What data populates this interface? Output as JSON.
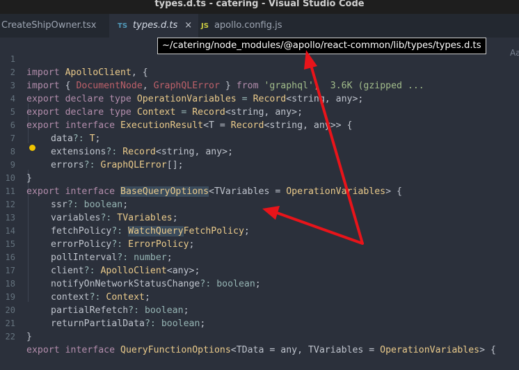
{
  "window": {
    "title": "types.d.ts - catering - Visual Studio Code"
  },
  "tabs": [
    {
      "label": "CreateShipOwner.tsx",
      "icon": ""
    },
    {
      "label": "types.d.ts",
      "icon": "TS",
      "close": "×"
    },
    {
      "label": "apollo.config.js",
      "icon": "JS"
    }
  ],
  "tooltip": {
    "path": "~/catering/node_modules/@apollo/react-common/lib/types/types.d.ts"
  },
  "find_widget": {
    "label": "Aa"
  },
  "lines": {
    "l1": {
      "n": "1",
      "a": "import",
      "b": "ApolloClient",
      "c": ", {"
    },
    "l2": {
      "n": "2",
      "a": "import",
      "b": "{ ",
      "c": "DocumentNode",
      "d": ", ",
      "e": "GraphQLError",
      "f": " } ",
      "g": "from",
      "h": " ",
      "i": "'graphql'",
      "j": ";  3.6K (gzipped ..."
    },
    "l3": {
      "n": "3",
      "a": "export declare type",
      "b": "OperationVariables",
      "c": " = ",
      "d": "Record",
      "e": "<string, any>;"
    },
    "l4": {
      "n": "4",
      "a": "export declare type",
      "b": "Context",
      "c": " = ",
      "d": "Record",
      "e": "<string, any>;"
    },
    "l5": {
      "n": "5",
      "a": "export interface",
      "b": "ExecutionResult",
      "c": "<T = ",
      "d": "Record",
      "e": "<string, any>> {"
    },
    "l6": {
      "n": "6",
      "a": "data",
      "b": "?: ",
      "c": "T",
      "d": ";"
    },
    "l7": {
      "n": "7",
      "a": "extensions",
      "b": "?: ",
      "c": "Record",
      "d": "<string, any>;"
    },
    "l8": {
      "n": "8",
      "a": "errors",
      "b": "?: ",
      "c": "GraphQLError",
      "d": "[];"
    },
    "l9": {
      "n": "9",
      "a": "}"
    },
    "l10": {
      "n": "10",
      "a": "export interface",
      "b": "BaseQueryOptions",
      "c": "<TVariables = ",
      "d": "OperationVariables",
      "e": "> {"
    },
    "l11": {
      "n": "11",
      "a": "ssr",
      "b": "?: ",
      "c": "boolean",
      "d": ";"
    },
    "l12": {
      "n": "12",
      "a": "variables",
      "b": "?: ",
      "c": "TVariables",
      "d": ";"
    },
    "l13": {
      "n": "13",
      "a": "fetchPolicy",
      "b": "?: ",
      "c": "WatchQuery",
      "d": "FetchPolicy",
      "e": ";"
    },
    "l14": {
      "n": "14",
      "a": "errorPolicy",
      "b": "?: ",
      "c": "ErrorPolicy",
      "d": ";"
    },
    "l15": {
      "n": "15",
      "a": "pollInterval",
      "b": "?: ",
      "c": "number",
      "d": ";"
    },
    "l16": {
      "n": "16",
      "a": "client",
      "b": "?: ",
      "c": "ApolloClient",
      "d": "<any>;"
    },
    "l17": {
      "n": "17",
      "a": "notifyOnNetworkStatusChange",
      "b": "?: ",
      "c": "boolean",
      "d": ";"
    },
    "l18": {
      "n": "18",
      "a": "context",
      "b": "?: ",
      "c": "Context",
      "d": ";"
    },
    "l19": {
      "n": "19",
      "a": "partialRefetch",
      "b": "?: ",
      "c": "boolean",
      "d": ";"
    },
    "l20": {
      "n": "20",
      "a": "returnPartialData",
      "b": "?: ",
      "c": "boolean",
      "d": ";"
    },
    "l21": {
      "n": "21",
      "a": "}"
    },
    "l22": {
      "n": "22",
      "a": "export interface",
      "b": "QueryFunctionOptions",
      "c": "<TData = any, TVariables = ",
      "d": "OperationVariables",
      "e": "> {"
    }
  },
  "colors": {
    "annotation_arrow": "#e8141a",
    "editor_bg": "#2b303b",
    "tooltip_bg": "#000000"
  }
}
